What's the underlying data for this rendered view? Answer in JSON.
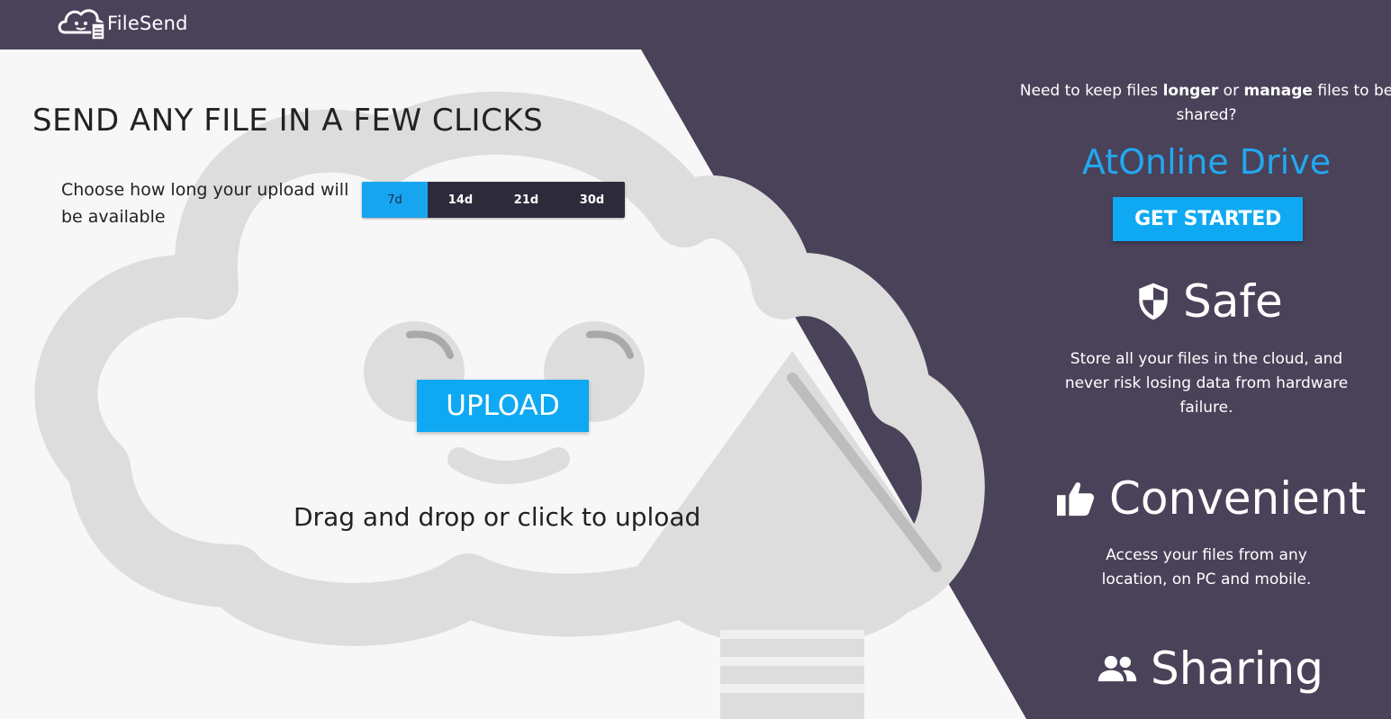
{
  "brand": {
    "name": "FileSend",
    "logo_icon": "cloud-file-icon"
  },
  "main": {
    "headline": "SEND ANY FILE IN A FEW CLICKS",
    "duration_label": "Choose how long your upload will be available",
    "durations": [
      {
        "label": "7d",
        "selected": true
      },
      {
        "label": "14d",
        "selected": false
      },
      {
        "label": "21d",
        "selected": false
      },
      {
        "label": "30d",
        "selected": false
      }
    ],
    "upload_label": "UPLOAD",
    "drag_text": "Drag and drop or click to upload"
  },
  "promo": {
    "question_parts": [
      "Need to keep files ",
      "longer",
      " or ",
      "manage",
      " files to be shared?"
    ],
    "drive_title": "AtOnline Drive",
    "cta_label": "GET STARTED",
    "features": [
      {
        "icon": "shield-icon",
        "title": "Safe",
        "description": "Store all your files in the cloud, and never risk losing data from hardware failure."
      },
      {
        "icon": "thumbs-up-icon",
        "title": "Convenient",
        "description": "Access your files from any location, on PC and mobile."
      },
      {
        "icon": "people-icon",
        "title": "Sharing",
        "description": ""
      }
    ]
  },
  "colors": {
    "dark_bg": "#4a4259",
    "light_panel": "#f7f7f8",
    "accent": "#0ea9f2",
    "segment_bg": "#2d2b3b",
    "cloud_shape": "#dedede"
  }
}
